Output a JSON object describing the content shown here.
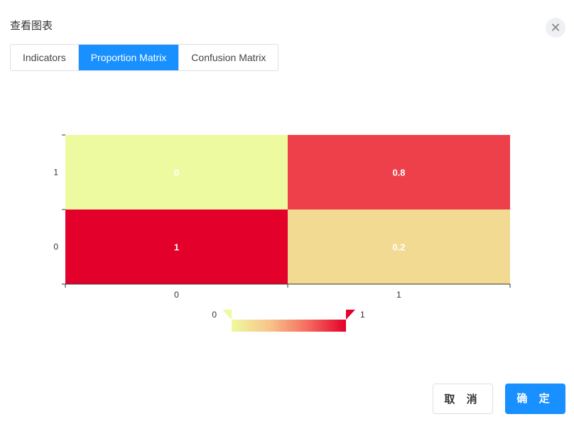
{
  "dialog": {
    "title": "查看图表",
    "close_icon": "close-icon"
  },
  "tabs": [
    {
      "label": "Indicators",
      "active": false
    },
    {
      "label": "Proportion Matrix",
      "active": true
    },
    {
      "label": "Confusion Matrix",
      "active": false
    }
  ],
  "chart_data": {
    "type": "heatmap",
    "x_categories": [
      "0",
      "1"
    ],
    "y_categories": [
      "0",
      "1"
    ],
    "values": [
      {
        "x": "0",
        "y": "1",
        "v": 0
      },
      {
        "x": "1",
        "y": "1",
        "v": 0.8
      },
      {
        "x": "0",
        "y": "0",
        "v": 1
      },
      {
        "x": "1",
        "y": "0",
        "v": 0.2
      }
    ],
    "cell_labels": [
      "0",
      "0.8",
      "1",
      "0.2"
    ],
    "visual_map": {
      "min": 0,
      "max": 1,
      "min_label": "0",
      "max_label": "1",
      "colors": [
        "#eefaa0",
        "#f7c48a",
        "#f56b5f",
        "#e3002b"
      ],
      "placement": "bottom-center"
    }
  },
  "buttons": {
    "cancel": "取 消",
    "ok": "确 定"
  }
}
